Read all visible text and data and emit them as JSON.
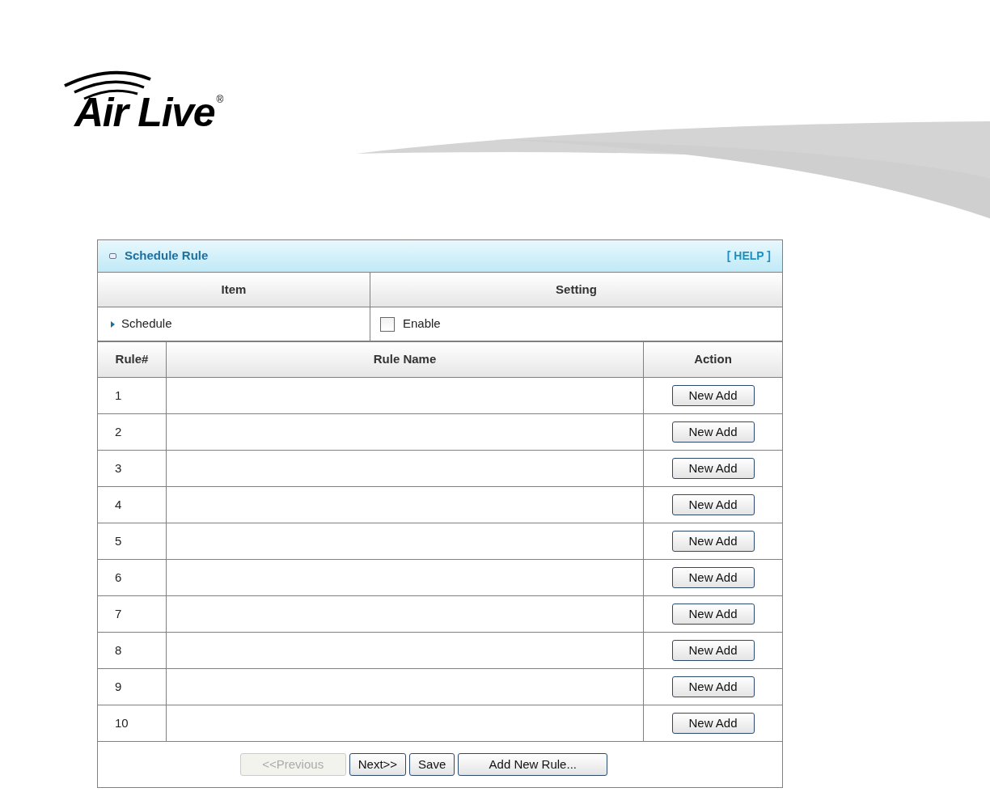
{
  "logo": {
    "text": "Air Live",
    "mark": "®"
  },
  "panel": {
    "title": "Schedule Rule",
    "help": "[ HELP ]"
  },
  "settings": {
    "columns": [
      "Item",
      "Setting"
    ],
    "rows": [
      {
        "label": "Schedule",
        "option": "Enable",
        "checked": false
      }
    ]
  },
  "rules": {
    "columns": [
      "Rule#",
      "Rule Name",
      "Action"
    ],
    "rows": [
      {
        "number": "1",
        "action": "New Add"
      },
      {
        "number": "2",
        "action": "New Add"
      },
      {
        "number": "3",
        "action": "New Add"
      },
      {
        "number": "4",
        "action": "New Add"
      },
      {
        "number": "5",
        "action": "New Add"
      },
      {
        "number": "6",
        "action": "New Add"
      },
      {
        "number": "7",
        "action": "New Add"
      },
      {
        "number": "8",
        "action": "New Add"
      },
      {
        "number": "9",
        "action": "New Add"
      },
      {
        "number": "10",
        "action": "New Add"
      }
    ]
  },
  "buttons": [
    {
      "label": "<<Previous",
      "disabled": true
    },
    {
      "label": "Next>>",
      "disabled": false
    },
    {
      "label": "Save",
      "disabled": false
    },
    {
      "label": "Add New Rule...",
      "disabled": false
    }
  ]
}
